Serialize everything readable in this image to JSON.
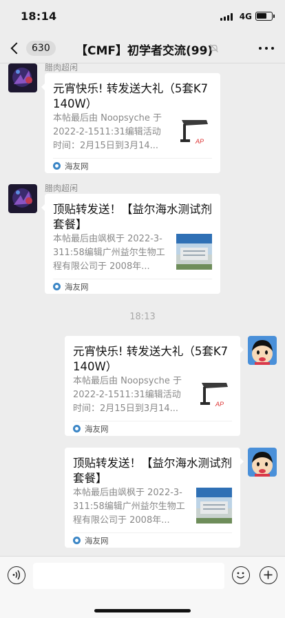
{
  "status_bar": {
    "time": "18:14",
    "network": "4G"
  },
  "nav": {
    "back_badge": "630",
    "title": "【CMF】初学者交流(99)"
  },
  "messages": [
    {
      "sender": "腊肉超闲",
      "title": "元宵快乐! 转发送大礼（5套K7  140W）",
      "desc": "本帖最后由 Noopsyche 于 2022-2-1511:31编辑活动时间：2月15日到3月14...",
      "source": "海友网",
      "thumb_text": "AP"
    },
    {
      "sender": "腊肉超闲",
      "title": "顶贴转发送！【益尔海水测试剂套餐】",
      "desc": "本帖最后由飒枫于 2022-3-311:58编辑广州益尔生物工程有限公司于 2008年...",
      "source": "海友网",
      "thumb_text": "以匠心精神 服务海水爱好者"
    },
    {
      "timestamp": "18:13"
    },
    {
      "title": "元宵快乐! 转发送大礼（5套K7  140W）",
      "desc": "本帖最后由 Noopsyche 于 2022-2-1511:31编辑活动时间：2月15日到3月14...",
      "source": "海友网",
      "thumb_text": "AP"
    },
    {
      "title": "顶贴转发送！【益尔海水测试剂套餐】",
      "desc": "本帖最后由飒枫于 2022-3-311:58编辑广州益尔生物工程有限公司于 2008年...",
      "source": "海友网",
      "thumb_text": "以匠心精神 服务海水爱好者"
    }
  ],
  "icons": {
    "back": "chevron-left-icon",
    "mute": "bell-muted-icon",
    "more": "ellipsis-icon",
    "voice": "voice-icon",
    "emoji": "emoji-icon",
    "plus": "plus-circle-icon",
    "source": "source-logo-icon"
  },
  "colors": {
    "background": "#ededed",
    "bubble": "#ffffff",
    "source_blue": "#3b86c6"
  }
}
